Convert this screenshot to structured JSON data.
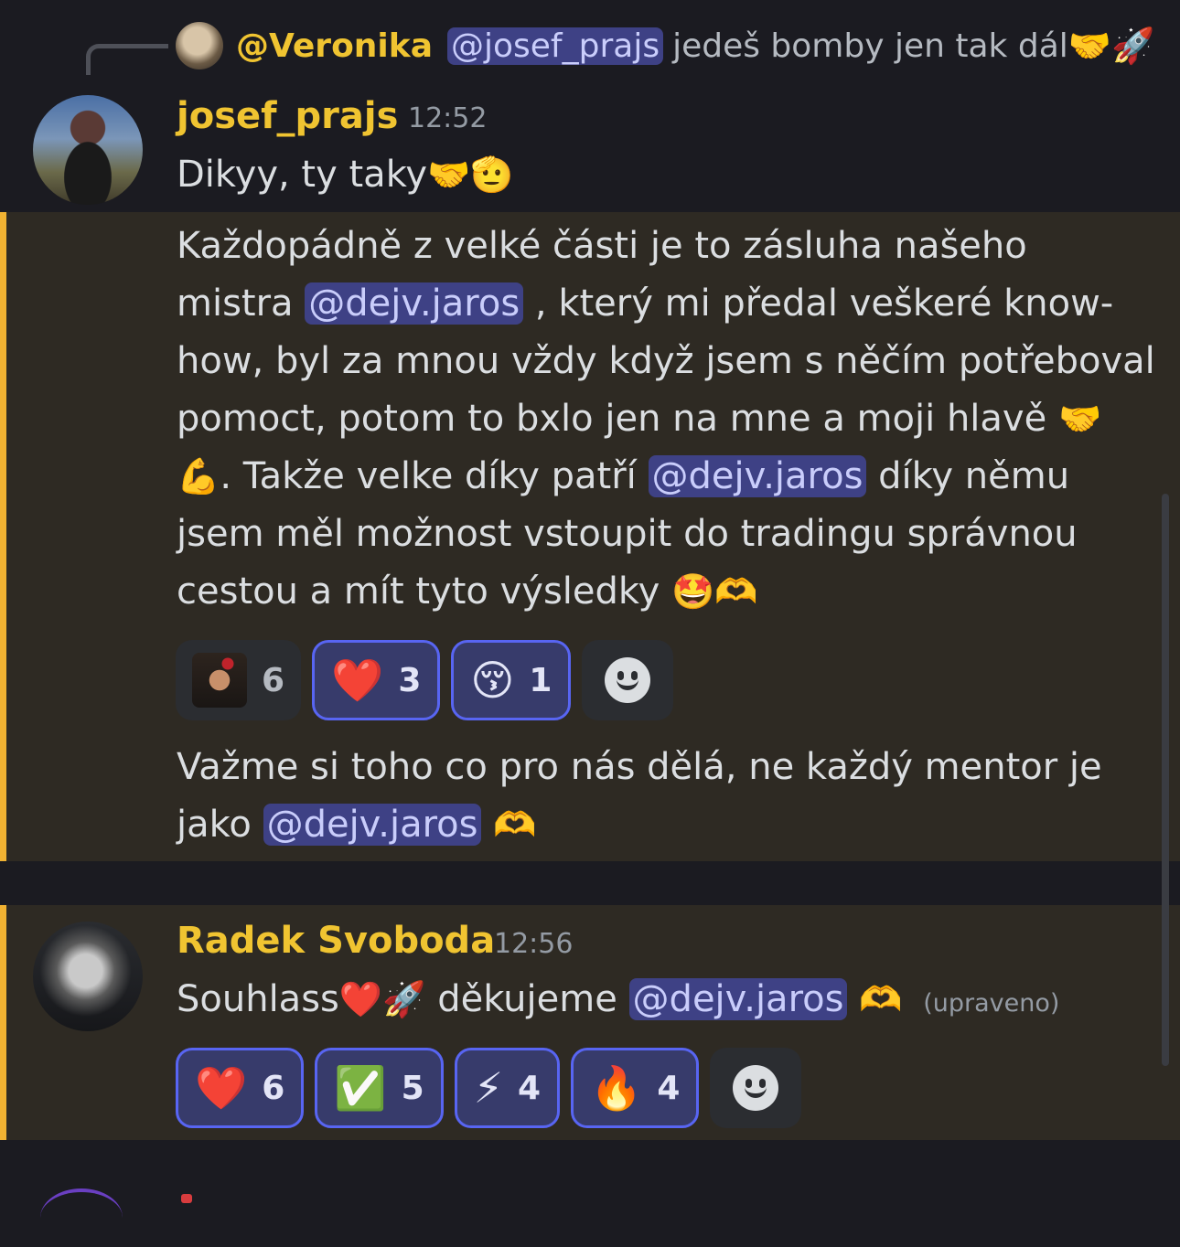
{
  "reply": {
    "author": "@Veronika",
    "mention": "@josef_prajs",
    "text": "jedeš bomby jen tak dál",
    "emojis": "🤝🚀"
  },
  "message1": {
    "author": "josef_prajs",
    "time": "12:52",
    "line1_text": "Dikyy, ty taky",
    "line1_emojis": "🤝🫡"
  },
  "message2": {
    "l1": "Každopádně z velké části je to zásluha našeho",
    "l2_a": "mistra",
    "l2_mention": "@dejv.jaros",
    "l2_b": ", který mi předal veškeré know-",
    "l3": "how, byl za mnou vždy když jsem s něčím potřeboval",
    "l4": "pomoct, potom to bxlo jen na mne a moji hlavě",
    "l4_emoji": "🤝",
    "l5_emoji": "💪",
    "l5_a": ". Takže velke díky patří",
    "l5_mention": "@dejv.jaros",
    "l5_b": "díky němu",
    "l6": "jsem měl možnost vstoupit do tradingu správnou",
    "l7": "cestou a mít tyto výsledky",
    "l7_emojis": "🤩🫶",
    "reactions": [
      {
        "type": "custom-avatar",
        "count": "6",
        "active": false
      },
      {
        "emoji": "❤️",
        "count": "3",
        "active": true
      },
      {
        "emoji": "😚",
        "count": "1",
        "active": true
      }
    ]
  },
  "message3": {
    "l1": "Važme si toho co pro nás dělá, ne každý mentor je",
    "l2_a": "jako",
    "l2_mention": "@dejv.jaros",
    "l2_emoji": "🫶"
  },
  "message4": {
    "author": "Radek Svoboda",
    "time": "12:56",
    "text_a": "Souhlass",
    "emojis_a": "❤️🚀",
    "text_b": "děkujeme",
    "mention": "@dejv.jaros",
    "emoji_b": "🫶",
    "edited": "(upraveno)",
    "reactions": [
      {
        "emoji": "❤️",
        "count": "6",
        "active": true
      },
      {
        "emoji": "✅",
        "count": "5",
        "active": true
      },
      {
        "emoji": "⚡",
        "count": "4",
        "active": true
      },
      {
        "emoji": "🔥",
        "count": "4",
        "active": true
      }
    ]
  },
  "icons": {
    "add_reaction": "smile-icon"
  },
  "colors": {
    "background": "#1b1b21",
    "highlight": "#2e2a23",
    "highlight_border": "#f0b232",
    "username": "#f0c431",
    "mention_bg": "#3e4185",
    "reaction_active_border": "#5865f2"
  }
}
